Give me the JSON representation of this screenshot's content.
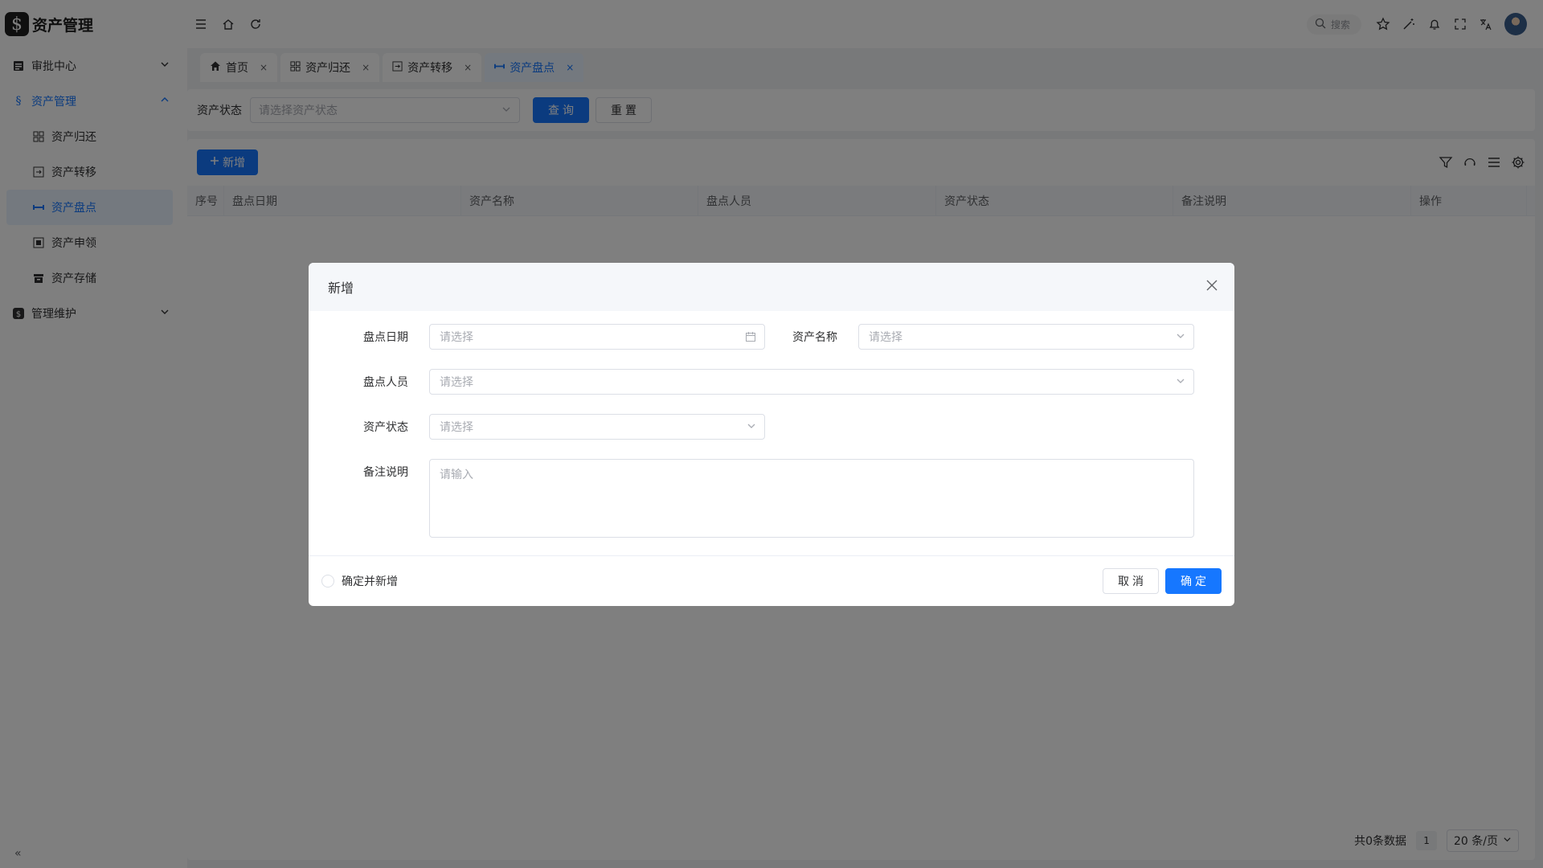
{
  "app": {
    "logo_glyph": "$",
    "title": "资产管理"
  },
  "sidebar": {
    "items": [
      {
        "label": "审批中心",
        "icon": "document-icon"
      },
      {
        "label": "资产管理",
        "icon": "dollar-icon"
      },
      {
        "label": "管理维护",
        "icon": "dollar-badge-icon"
      }
    ],
    "sub_items": [
      {
        "label": "资产归还",
        "icon": "grid-icon"
      },
      {
        "label": "资产转移",
        "icon": "transfer-icon"
      },
      {
        "label": "资产盘点",
        "icon": "inventory-icon"
      },
      {
        "label": "资产申领",
        "icon": "apply-icon"
      },
      {
        "label": "资产存储",
        "icon": "storage-icon"
      }
    ],
    "collapse_glyph": "«"
  },
  "header": {
    "search_label": "搜索"
  },
  "tabs": [
    {
      "label": "首页",
      "close": "×"
    },
    {
      "label": "资产归还",
      "close": "×"
    },
    {
      "label": "资产转移",
      "close": "×"
    },
    {
      "label": "资产盘点",
      "close": "×"
    }
  ],
  "search": {
    "status_label": "资产状态",
    "status_placeholder": "请选择资产状态",
    "query_button": "查询",
    "reset_button": "重置"
  },
  "table": {
    "add_button": "新增",
    "columns": [
      "序号",
      "盘点日期",
      "资产名称",
      "盘点人员",
      "资产状态",
      "备注说明",
      "操作"
    ]
  },
  "pagination": {
    "total_text": "共0条数据",
    "page": "1",
    "page_size": "20 条/页"
  },
  "dialog": {
    "title": "新增",
    "fields": {
      "check_date": {
        "label": "盘点日期",
        "placeholder": "请选择"
      },
      "asset_name": {
        "label": "资产名称",
        "placeholder": "请选择"
      },
      "checker": {
        "label": "盘点人员",
        "placeholder": "请选择"
      },
      "asset_status": {
        "label": "资产状态",
        "placeholder": "请选择"
      },
      "remark": {
        "label": "备注说明",
        "placeholder": "请输入"
      }
    },
    "confirm_and_add": "确定并新增",
    "cancel_button": "取消",
    "confirm_button": "确定"
  },
  "colors": {
    "primary": "#1677ff",
    "active_bg": "#e8f3ff"
  }
}
